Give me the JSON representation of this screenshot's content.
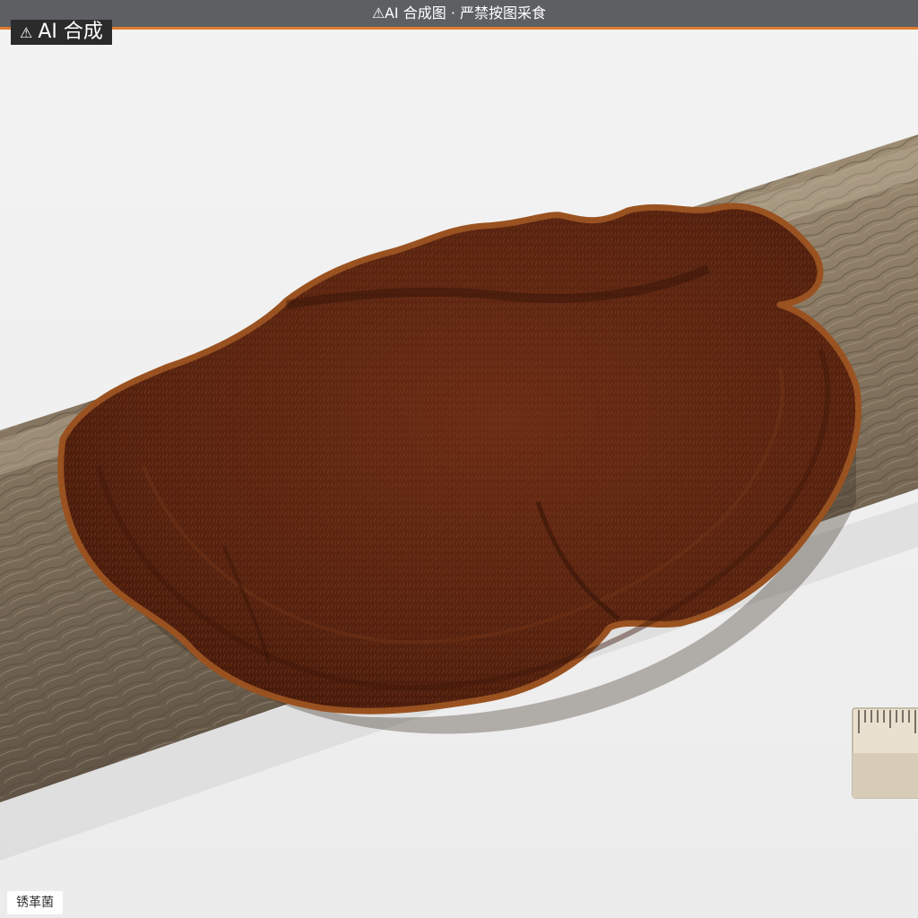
{
  "banner": {
    "icon": "warning-icon",
    "text": "AI 合成图 · 严禁按图采食"
  },
  "ai_tag": {
    "icon": "warning-icon",
    "text": "AI 合成"
  },
  "caption": {
    "species_name": "锈革菌"
  },
  "colors": {
    "banner_bg": "#5d5f63",
    "banner_accent": "#e07b2e",
    "fungus_body": "#5a2512",
    "fungus_rim": "#9a5220",
    "log_bark": "#8a7a64",
    "background": "#f1f1f1"
  }
}
